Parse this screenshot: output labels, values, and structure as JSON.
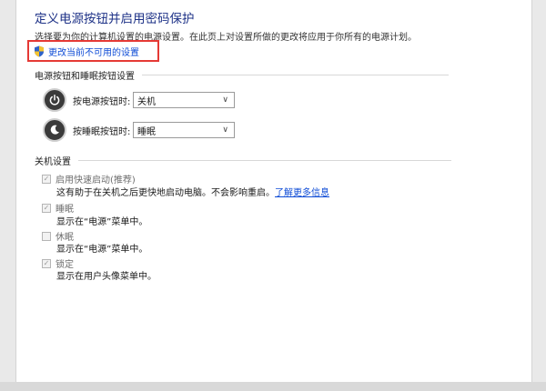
{
  "page": {
    "title": "定义电源按钮并启用密码保护",
    "subtitle": "选择要为你的计算机设置的电源设置。在此页上对设置所做的更改将应用于你所有的电源计划。",
    "change_link": "更改当前不可用的设置"
  },
  "power_section": {
    "title": "电源按钮和睡眠按钮设置",
    "rows": [
      {
        "label": "按电源按钮时:",
        "value": "关机",
        "icon": "power-icon"
      },
      {
        "label": "按睡眠按钮时:",
        "value": "睡眠",
        "icon": "moon-icon"
      }
    ]
  },
  "shutdown_section": {
    "title": "关机设置",
    "options": [
      {
        "label": "启用快速启动(推荐)",
        "checked": true,
        "desc": "这有助于在关机之后更快地启动电脑。不会影响重启。",
        "link": "了解更多信息"
      },
      {
        "label": "睡眠",
        "checked": true,
        "desc": "显示在“电源”菜单中。"
      },
      {
        "label": "休眠",
        "checked": false,
        "desc": "显示在“电源”菜单中。"
      },
      {
        "label": "锁定",
        "checked": true,
        "desc": "显示在用户头像菜单中。"
      }
    ]
  },
  "colors": {
    "title": "#1e3287",
    "link": "#0f4cd6",
    "highlight": "#e53935"
  }
}
